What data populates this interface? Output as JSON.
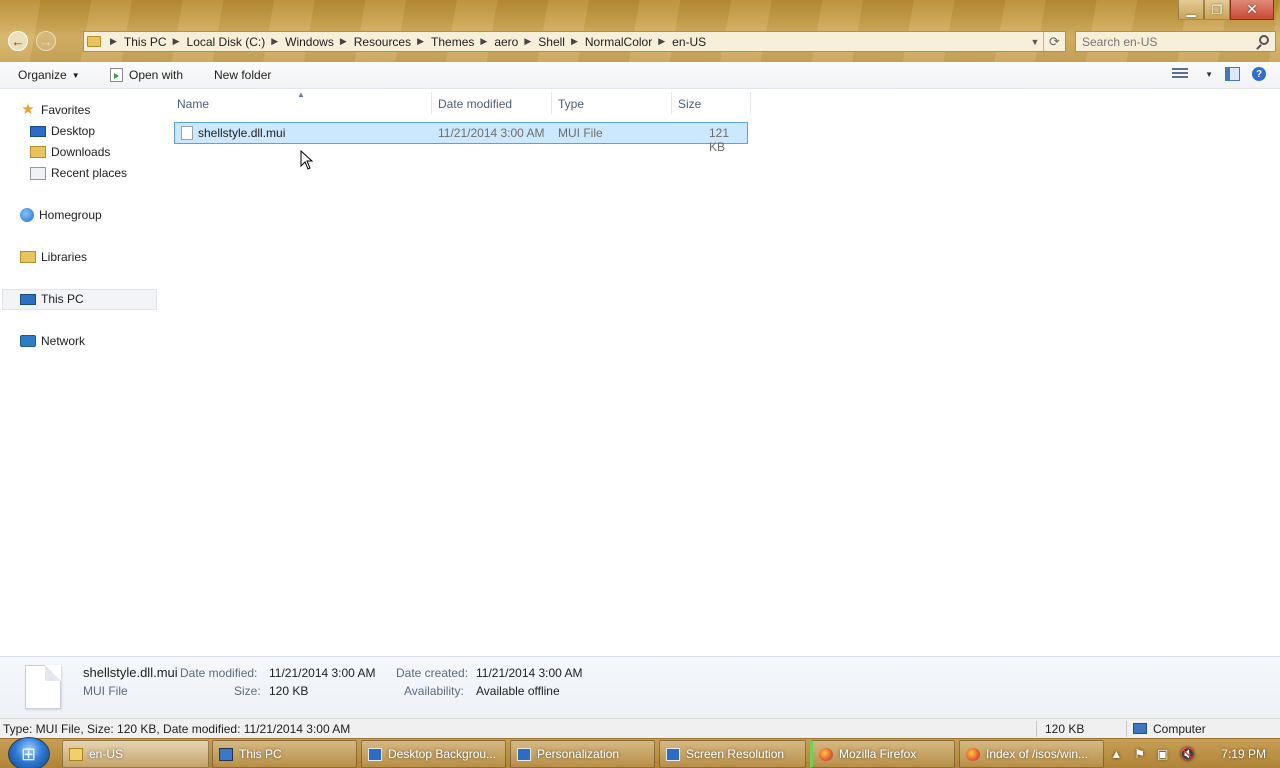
{
  "window": {
    "caption": {
      "minimize": "▁",
      "maximize": "❐",
      "close": "✕"
    },
    "back_glyph": "←",
    "forward_glyph": "→"
  },
  "address": {
    "crumbs": [
      "This PC",
      "Local Disk (C:)",
      "Windows",
      "Resources",
      "Themes",
      "aero",
      "Shell",
      "NormalColor",
      "en-US"
    ],
    "separator": "▶"
  },
  "search": {
    "placeholder": "Search en-US"
  },
  "toolbar": {
    "organize_label": "Organize",
    "open_with_label": "Open with",
    "new_folder_label": "New folder",
    "help_glyph": "?"
  },
  "navpane": {
    "favorites": "Favorites",
    "desktop": "Desktop",
    "downloads": "Downloads",
    "recent_places": "Recent places",
    "homegroup": "Homegroup",
    "libraries": "Libraries",
    "this_pc": "This PC",
    "network": "Network"
  },
  "columns": {
    "name": "Name",
    "date_modified": "Date modified",
    "type": "Type",
    "size": "Size"
  },
  "files": [
    {
      "name": "shellstyle.dll.mui",
      "date_modified": "11/21/2014 3:00 AM",
      "type": "MUI File",
      "size": "121 KB"
    }
  ],
  "details": {
    "filename": "shellstyle.dll.mui",
    "filetype": "MUI File",
    "date_modified_label": "Date modified:",
    "date_modified": "11/21/2014 3:00 AM",
    "size_label": "Size:",
    "size": "120 KB",
    "date_created_label": "Date created:",
    "date_created": "11/21/2014 3:00 AM",
    "availability_label": "Availability:",
    "availability": "Available offline"
  },
  "statusbar": {
    "text": "Type: MUI File, Size: 120 KB, Date modified: 11/21/2014 3:00 AM",
    "size": "120 KB",
    "location": "Computer"
  },
  "taskbar": {
    "buttons": [
      {
        "label": "en-US"
      },
      {
        "label": "This PC"
      },
      {
        "label": "Desktop Backgrou..."
      },
      {
        "label": "Personalization"
      },
      {
        "label": "Screen Resolution"
      },
      {
        "label": "Mozilla Firefox"
      },
      {
        "label": "Index of /isos/win..."
      }
    ],
    "clock": "7:19 PM",
    "tray_icons": [
      "up-arrow",
      "flag",
      "network",
      "speaker-muted"
    ],
    "tray_glyphs": {
      "arrow": "▲",
      "flag": "⚑",
      "network": "▣",
      "speaker": "🔇"
    }
  }
}
